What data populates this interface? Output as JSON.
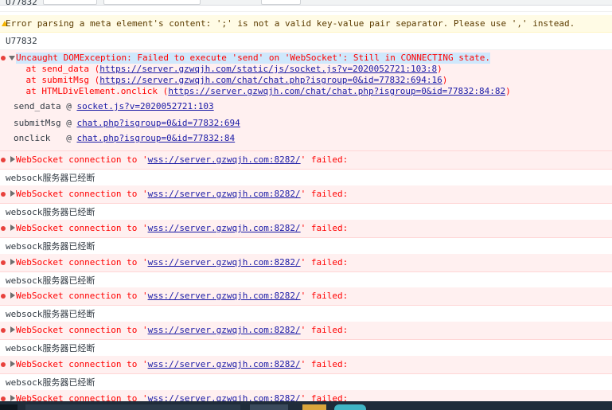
{
  "top_text": "U77832",
  "warning": {
    "text": "Error parsing a meta element's content: ';' is not a valid key-value pair separator. Please use ',' instead."
  },
  "log_u": "U77832",
  "exception": {
    "header": "Uncaught DOMException: Failed to execute 'send' on 'WebSocket': Still in CONNECTING state.",
    "stack": [
      {
        "prefix": "    at send_data (",
        "url": "https://server.gzwqjh.com/static/js/socket.js?v=2020052721:103:8",
        "suffix": ")"
      },
      {
        "prefix": "    at submitMsg (",
        "url": "https://server.gzwqjh.com/chat/chat.php?isgroup=0&id=77832:694:16",
        "suffix": ")"
      },
      {
        "prefix": "    at HTMLDivElement.onclick (",
        "url": "https://server.gzwqjh.com/chat/chat.php?isgroup=0&id=77832:84:82",
        "suffix": ")"
      }
    ],
    "frames": [
      {
        "name": "send_data @ ",
        "link": "socket.js?v=2020052721:103"
      },
      {
        "name": "submitMsg @ ",
        "link": "chat.php?isgroup=0&id=77832:694"
      },
      {
        "name": "onclick   @ ",
        "link": "chat.php?isgroup=0&id=77832:84"
      }
    ]
  },
  "ws_error": {
    "prefix": "WebSocket connection to '",
    "url": "wss://server.gzwqjh.com:8282/",
    "suffix": "' failed:"
  },
  "disconnect_log": "websock服务器已经断",
  "colors": {
    "error_text": "#ff0000",
    "error_bg": "#fff0f0",
    "warning_bg": "#fffbe5",
    "link": "#1a1aa6",
    "selection": "#cfe8fc"
  }
}
